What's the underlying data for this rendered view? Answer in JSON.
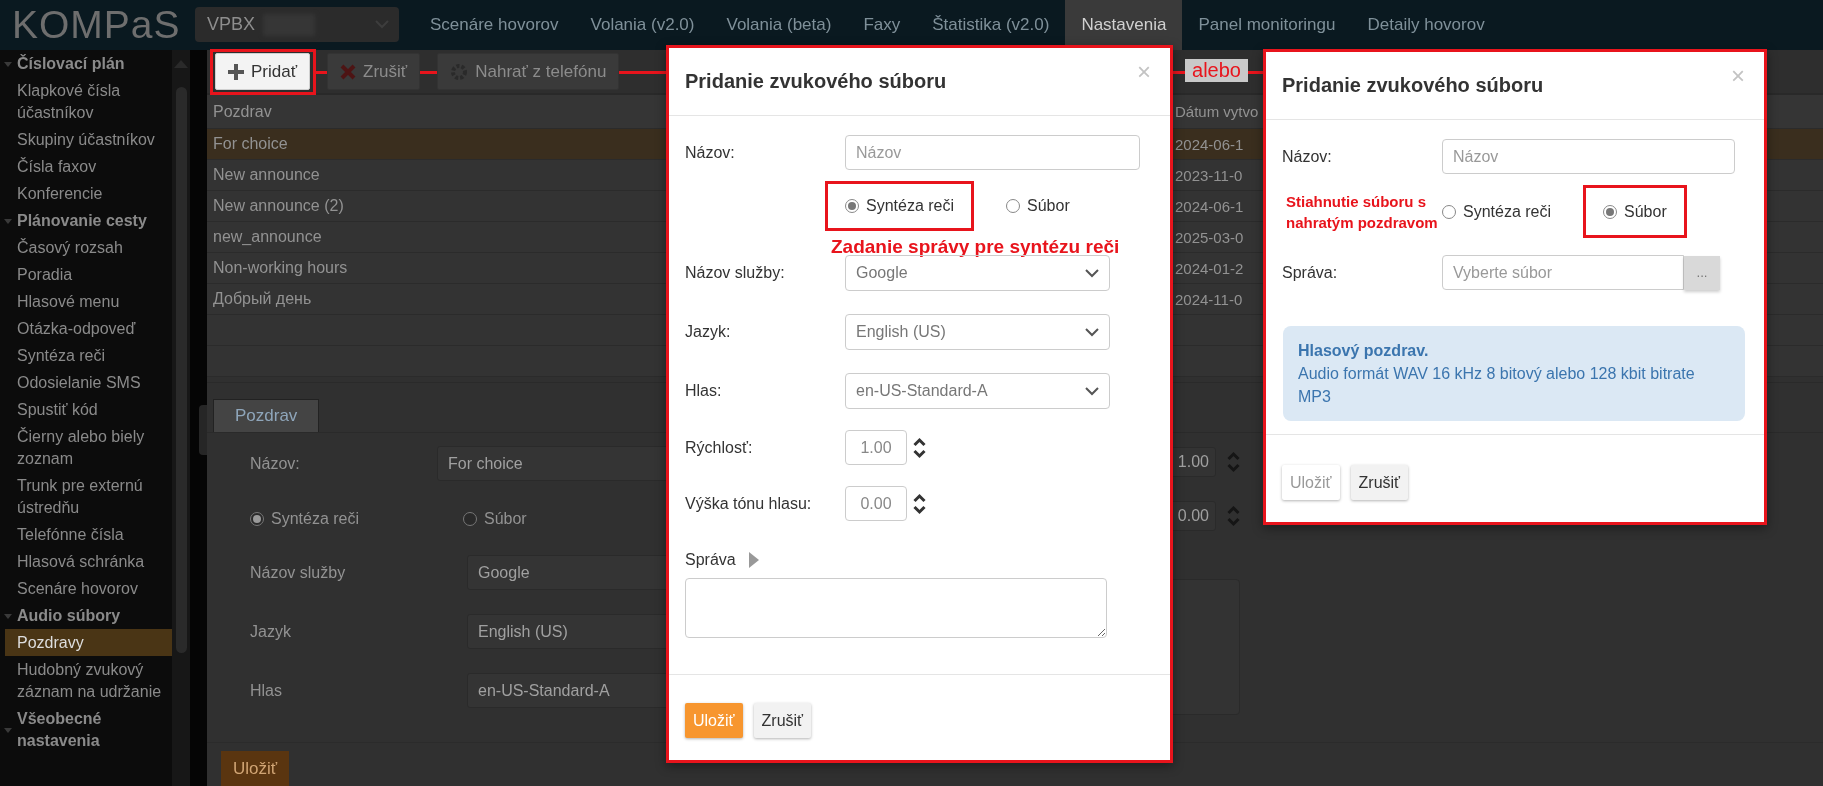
{
  "header": {
    "logo": "KOMPaS",
    "account": {
      "label": "VPBX"
    },
    "nav": [
      {
        "label": "Scenáre hovorov",
        "selected": false
      },
      {
        "label": "Volania (v2.0)",
        "selected": false
      },
      {
        "label": "Volania (beta)",
        "selected": false
      },
      {
        "label": "Faxy",
        "selected": false
      },
      {
        "label": "Štatistika (v2.0)",
        "selected": false
      },
      {
        "label": "Nastavenia",
        "selected": true
      },
      {
        "label": "Panel monitoringu",
        "selected": false
      },
      {
        "label": "Detaily hovorov",
        "selected": false
      }
    ]
  },
  "sidebar": {
    "groups": [
      {
        "label": "Číslovací plán",
        "expanded": true,
        "children": [
          {
            "label": "Klapkové čísla účastníkov",
            "selected": false
          },
          {
            "label": "Skupiny účastníkov",
            "selected": false
          },
          {
            "label": "Čísla faxov",
            "selected": false
          },
          {
            "label": "Konferencie",
            "selected": false
          }
        ]
      },
      {
        "label": "Plánovanie cesty",
        "expanded": true,
        "children": [
          {
            "label": "Časový rozsah",
            "selected": false
          },
          {
            "label": "Poradia",
            "selected": false
          },
          {
            "label": "Hlasové menu",
            "selected": false
          },
          {
            "label": "Otázka-odpoveď",
            "selected": false
          },
          {
            "label": "Syntéza reči",
            "selected": false
          },
          {
            "label": "Odosielanie SMS",
            "selected": false
          },
          {
            "label": "Spustiť kód",
            "selected": false
          },
          {
            "label": "Čierny alebo biely zoznam",
            "selected": false
          },
          {
            "label": "Trunk pre externú ústredňu",
            "selected": false
          },
          {
            "label": "Telefónne čísla",
            "selected": false
          },
          {
            "label": "Hlasová schránka",
            "selected": false
          },
          {
            "label": "Scenáre hovorov",
            "selected": false
          }
        ]
      },
      {
        "label": "Audio súbory",
        "expanded": true,
        "children": [
          {
            "label": "Pozdravy",
            "selected": true
          },
          {
            "label": "Hudobný zvukový záznam na udržanie",
            "selected": false
          }
        ]
      },
      {
        "label": "Všeobecné nastavenia",
        "expanded": true
      }
    ]
  },
  "toolbar": {
    "buttons": [
      {
        "kind": "add",
        "label": "Pridať",
        "annotated": true
      },
      {
        "kind": "delete",
        "label": "Zrušiť",
        "annotated": false
      },
      {
        "kind": "phone",
        "label": "Nahrať z telefónu",
        "annotated": false
      }
    ]
  },
  "table": {
    "columns": [
      "Pozdrav",
      "Dátum vytvo"
    ],
    "rows": [
      {
        "name": "For choice",
        "date": "2024-06-1",
        "selected": true
      },
      {
        "name": "New announce",
        "date": "2023-11-0",
        "selected": false
      },
      {
        "name": "New announce (2)",
        "date": "2024-06-1",
        "selected": false
      },
      {
        "name": "new_announce",
        "date": "2025-03-0",
        "selected": false
      },
      {
        "name": "Non-working hours",
        "date": "2024-01-2",
        "selected": false
      },
      {
        "name": "Добрый день",
        "date": "2024-11-0",
        "selected": false
      }
    ]
  },
  "details": {
    "tabs": [
      {
        "label": "Pozdrav",
        "selected": true
      }
    ],
    "fields": [
      {
        "kind": "text",
        "label": "Názov:",
        "value": "For choice"
      },
      {
        "kind": "radio",
        "options": [
          {
            "label": "Syntéza reči",
            "selected": true
          },
          {
            "label": "Súbor",
            "selected": false
          }
        ]
      },
      {
        "kind": "select",
        "label": "Názov služby",
        "value": "Google"
      },
      {
        "kind": "select",
        "label": "Jazyk",
        "value": "English (US)"
      },
      {
        "kind": "select",
        "label": "Hlas",
        "value": "en-US-Standard-A"
      }
    ],
    "spinners": [
      {
        "value": "1.00"
      },
      {
        "value": "0.00"
      }
    ],
    "save": "Uložiť"
  },
  "connector": {
    "label": "alebo"
  },
  "dialogs": [
    {
      "title": "Pridanie zvukového súboru",
      "close": "×",
      "fields": [
        {
          "kind": "text",
          "label": "Názov:",
          "placeholder": "Názov"
        },
        {
          "kind": "radio",
          "options": [
            {
              "label": "Syntéza reči",
              "selected": true,
              "annotated": true
            },
            {
              "label": "Súbor",
              "selected": false,
              "annotated": false
            }
          ],
          "annotation": {
            "kind": "below",
            "text": "Zadanie správy pre syntézu reči"
          }
        },
        {
          "kind": "select",
          "label": "Názov služby:",
          "value": "Google"
        },
        {
          "kind": "select",
          "label": "Jazyk:",
          "value": "English (US)"
        },
        {
          "kind": "select",
          "label": "Hlas:",
          "value": "en-US-Standard-A"
        },
        {
          "kind": "spinner",
          "label": "Rýchlosť:",
          "value": "1.00"
        },
        {
          "kind": "spinner",
          "label": "Výška tónu hlasu:",
          "value": "0.00"
        },
        {
          "kind": "textarea",
          "label": "Správa"
        }
      ],
      "buttons": [
        {
          "kind": "save",
          "label": "Uložiť",
          "disabled": false
        },
        {
          "kind": "cancel",
          "label": "Zrušiť",
          "disabled": false
        }
      ]
    },
    {
      "title": "Pridanie zvukového súboru",
      "close": "×",
      "fields": [
        {
          "kind": "text",
          "label": "Názov:",
          "placeholder": "Názov"
        },
        {
          "kind": "radio",
          "options": [
            {
              "label": "Syntéza reči",
              "selected": false,
              "annotated": false
            },
            {
              "label": "Súbor",
              "selected": true,
              "annotated": true
            }
          ],
          "annotation": {
            "kind": "left",
            "text": "Stiahnutie súboru s nahratým pozdravom"
          }
        },
        {
          "kind": "file",
          "label": "Správa:",
          "placeholder": "Vyberte súbor",
          "button": "..."
        },
        {
          "kind": "info",
          "title": "Hlasový pozdrav.",
          "text": "Audio formát WAV 16 kHz 8 bitový alebo 128 kbit bitrate MP3"
        }
      ],
      "buttons": [
        {
          "kind": "save",
          "label": "Uložiť",
          "disabled": true
        },
        {
          "kind": "cancel",
          "label": "Zrušiť",
          "disabled": false
        }
      ]
    }
  ]
}
